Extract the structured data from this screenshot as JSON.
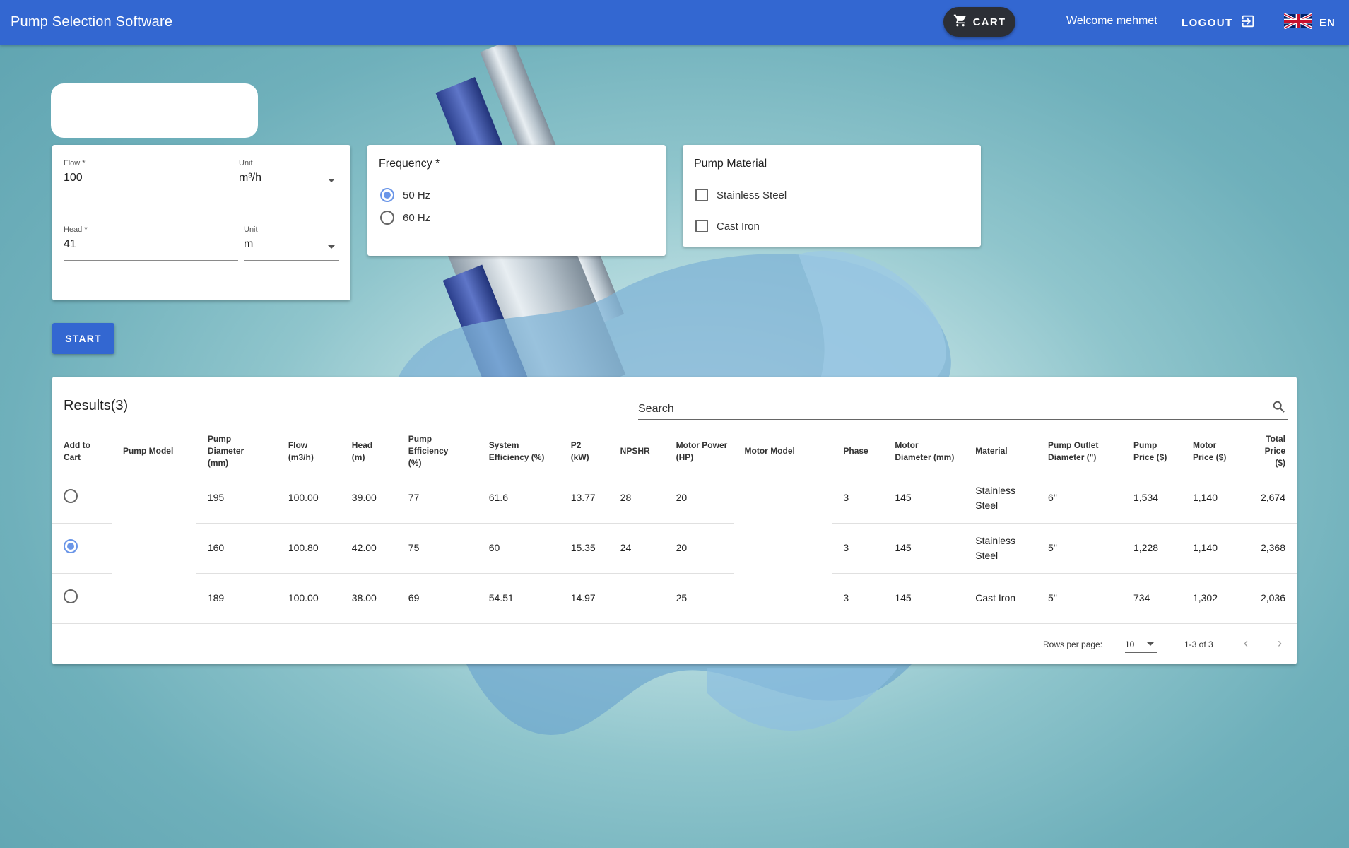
{
  "appbar": {
    "title": "Pump Selection Software",
    "cart_label": "CART",
    "welcome": "Welcome mehmet",
    "logout_label": "LOGOUT",
    "language": "EN"
  },
  "inputs": {
    "flow": {
      "label": "Flow *",
      "value": "100"
    },
    "flow_unit": {
      "label": "Unit",
      "value": "m³/h"
    },
    "head": {
      "label": "Head *",
      "value": "41"
    },
    "head_unit": {
      "label": "Unit",
      "value": "m"
    }
  },
  "frequency": {
    "title": "Frequency *",
    "options": [
      {
        "label": "50 Hz",
        "selected": true
      },
      {
        "label": "60 Hz",
        "selected": false
      }
    ]
  },
  "material": {
    "title": "Pump Material",
    "options": [
      {
        "label": "Stainless Steel",
        "checked": false
      },
      {
        "label": "Cast Iron",
        "checked": false
      }
    ]
  },
  "start_label": "START",
  "results": {
    "title": "Results(3)",
    "search_placeholder": "Search",
    "columns": [
      "Add to Cart",
      "Pump Model",
      "Pump Diameter (mm)",
      "Flow (m3/h)",
      "Head (m)",
      "Pump Efficiency (%)",
      "System Efficiency (%)",
      "P2 (kW)",
      "NPSHR",
      "Motor Power (HP)",
      "Motor Model",
      "Phase",
      "Motor Diameter (mm)",
      "Material",
      "Pump Outlet Diameter (\")",
      "Pump Price ($)",
      "Motor Price ($)",
      "Total Price ($)"
    ],
    "rows": [
      {
        "selected": false,
        "pump_model": "",
        "diameter": "195",
        "flow": "100.00",
        "head": "39.00",
        "pump_eff": "77",
        "sys_eff": "61.6",
        "p2": "13.77",
        "npshr": "28",
        "motor_power": "20",
        "motor_model": "",
        "phase": "3",
        "motor_diameter": "145",
        "material": "Stainless Steel",
        "outlet": "6\"",
        "pump_price": "1,534",
        "motor_price": "1,140",
        "total": "2,674"
      },
      {
        "selected": true,
        "pump_model": "",
        "diameter": "160",
        "flow": "100.80",
        "head": "42.00",
        "pump_eff": "75",
        "sys_eff": "60",
        "p2": "15.35",
        "npshr": "24",
        "motor_power": "20",
        "motor_model": "",
        "phase": "3",
        "motor_diameter": "145",
        "material": "Stainless Steel",
        "outlet": "5\"",
        "pump_price": "1,228",
        "motor_price": "1,140",
        "total": "2,368"
      },
      {
        "selected": false,
        "pump_model": "",
        "diameter": "189",
        "flow": "100.00",
        "head": "38.00",
        "pump_eff": "69",
        "sys_eff": "54.51",
        "p2": "14.97",
        "npshr": "",
        "motor_power": "25",
        "motor_model": "",
        "phase": "3",
        "motor_diameter": "145",
        "material": "Cast Iron",
        "outlet": "5\"",
        "pump_price": "734",
        "motor_price": "1,302",
        "total": "2,036"
      }
    ],
    "rows_per_page_label": "Rows per page:",
    "rows_per_page": "10",
    "range": "1-3 of 3"
  }
}
